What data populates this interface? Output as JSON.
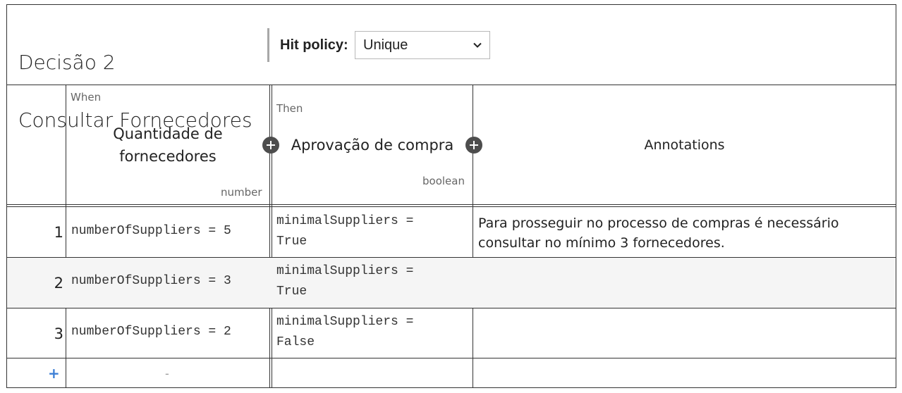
{
  "decision": {
    "name_line1": "Decisão 2",
    "name_line2": "Consultar Fornecedores",
    "hit_policy_label": "Hit policy:",
    "hit_policy_value": "Unique"
  },
  "columns": {
    "input": {
      "clause": "When",
      "label_line1": "Quantidade de",
      "label_line2": "fornecedores",
      "type": "number"
    },
    "output": {
      "clause": "Then",
      "label": "Aprovação de compra",
      "type": "boolean"
    },
    "annotations": {
      "label": "Annotations"
    }
  },
  "rules": [
    {
      "index": "1",
      "input": "numberOfSuppliers = 5",
      "output_line1": "minimalSuppliers =",
      "output_line2": "True",
      "annotation_line1": "Para prosseguir no processo de compras é necessário",
      "annotation_line2": "consultar no mínimo 3 fornecedores."
    },
    {
      "index": "2",
      "input": "numberOfSuppliers = 3",
      "output_line1": "minimalSuppliers =",
      "output_line2": "True",
      "annotation_line1": "",
      "annotation_line2": ""
    },
    {
      "index": "3",
      "input": "numberOfSuppliers = 2",
      "output_line1": "minimalSuppliers =",
      "output_line2": "False",
      "annotation_line1": "",
      "annotation_line2": ""
    }
  ],
  "footer": {
    "add_rule_symbol": "+",
    "empty_input": "-"
  },
  "icons": {
    "add_column": "plus-circle-icon",
    "hit_policy_dropdown": "chevron-down-icon"
  },
  "colors": {
    "alt_row": "#f5f5f5",
    "add_rule": "#3d7fd6",
    "add_column": "#4d4d4d"
  }
}
